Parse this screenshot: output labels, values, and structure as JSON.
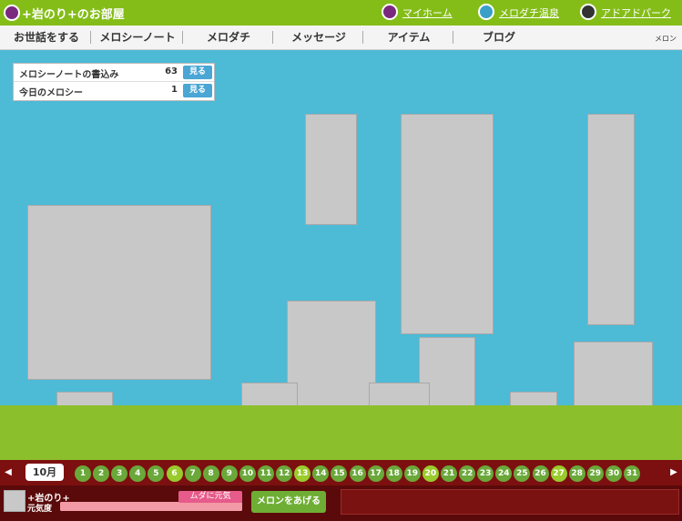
{
  "room": {
    "title": "+岩のり+のお部屋"
  },
  "nav": {
    "links": [
      {
        "label": "マイホーム",
        "color": "#7a2a7e"
      },
      {
        "label": "メロダチ温泉",
        "color": "#3aa0c8"
      },
      {
        "label": "アドアドパーク",
        "color": "#333333"
      }
    ]
  },
  "menu": {
    "items": [
      {
        "label": "お世話をする"
      },
      {
        "label": "メロシーノート"
      },
      {
        "label": "メロダチ"
      },
      {
        "label": "メッセージ"
      },
      {
        "label": "アイテム"
      },
      {
        "label": "ブログ"
      }
    ],
    "right_label": "メロン"
  },
  "info": {
    "rows": [
      {
        "label": "メロシーノートの書込み",
        "count": "63",
        "button": "見る"
      },
      {
        "label": "今日のメロシー",
        "count": "1",
        "button": "見る"
      }
    ]
  },
  "calendar": {
    "month": "10月",
    "left_arrow": "◀",
    "right_arrow": "▶",
    "days": [
      "1",
      "2",
      "3",
      "4",
      "5",
      "6",
      "7",
      "8",
      "9",
      "10",
      "11",
      "12",
      "13",
      "14",
      "15",
      "16",
      "17",
      "18",
      "19",
      "20",
      "21",
      "22",
      "23",
      "24",
      "25",
      "26",
      "27",
      "28",
      "29",
      "30",
      "31"
    ]
  },
  "status": {
    "name": "+岩のり+",
    "label": "元気度",
    "button": "ムダに元気",
    "fill": 1.0,
    "action": "メロンをあげる"
  },
  "colors": {
    "accent": "#84bd18",
    "room_bg": "#4dbad6",
    "floor": "#8cbf2c",
    "bottom_bar": "#7c1010"
  }
}
